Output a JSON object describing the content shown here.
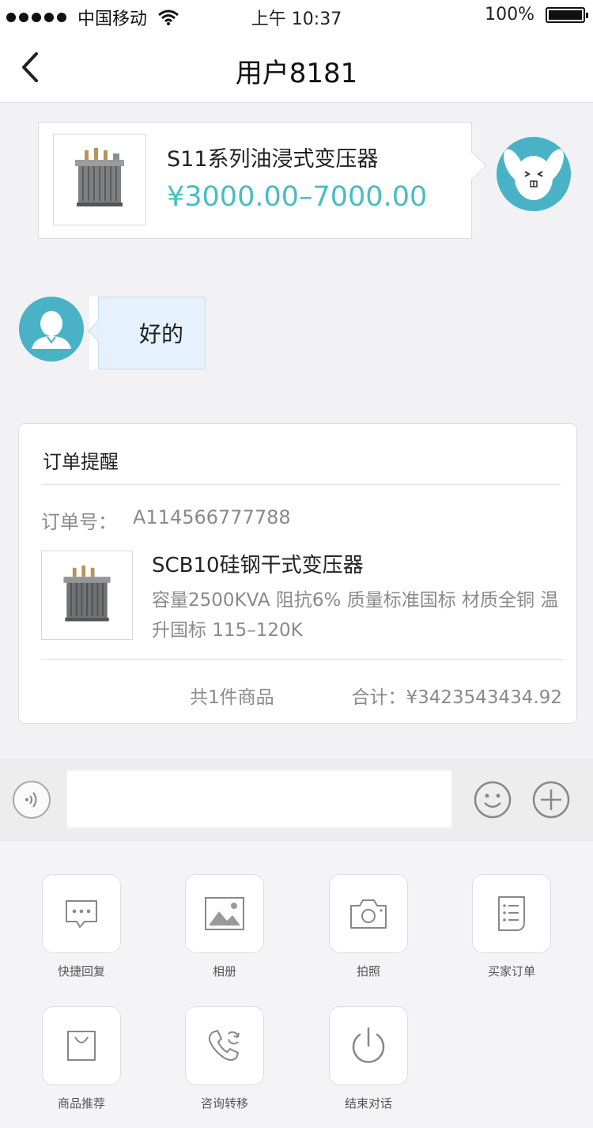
{
  "status_bar": {
    "carrier": "中国移动",
    "time": "上午 10:37",
    "battery": "100%"
  },
  "nav": {
    "title": "用户8181"
  },
  "product_message": {
    "name": "S11系列油浸式变压器",
    "price": "¥3000.00–7000.00"
  },
  "text_message": {
    "text": "好的"
  },
  "order_card": {
    "heading": "订单提醒",
    "order_no_label": "订单号：",
    "order_no": "A114566777788",
    "product_name": "SCB10硅钢干式变压器",
    "specs": "容量2500KVA  阻抗6%  质量标准国标  材质全铜  温升国标  115–120K",
    "count": "共1件商品",
    "total": "合计：¥3423543434.92"
  },
  "input_bar": {
    "placeholder": ""
  },
  "tools": [
    {
      "label": "快捷回复",
      "icon": "chat-bubble-icon"
    },
    {
      "label": "相册",
      "icon": "image-icon"
    },
    {
      "label": "拍照",
      "icon": "camera-icon"
    },
    {
      "label": "买家订单",
      "icon": "order-list-icon"
    },
    {
      "label": "商品推荐",
      "icon": "shopping-bag-icon"
    },
    {
      "label": "咨询转移",
      "icon": "phone-transfer-icon"
    },
    {
      "label": "结束对话",
      "icon": "power-icon"
    }
  ],
  "colors": {
    "accent": "#49bcc4",
    "avatar_bg": "#49b2c6",
    "bubble_bg": "#e5f1fc"
  }
}
